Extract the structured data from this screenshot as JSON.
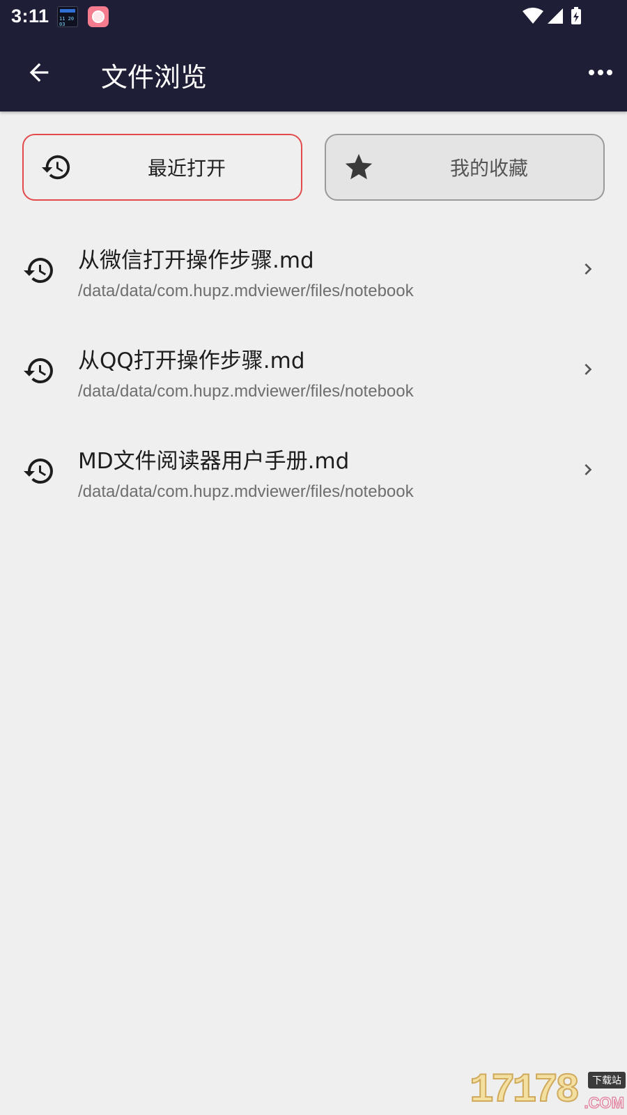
{
  "status_bar": {
    "time": "3:11",
    "icons": [
      "widget-clock-app-icon",
      "rice-bowl-app-icon",
      "wifi-icon",
      "cellular-signal-icon",
      "battery-charging-icon"
    ],
    "widget_digits": "11 20 03"
  },
  "header": {
    "title": "文件浏览",
    "back_icon": "arrow-back-icon",
    "menu_icon": "more-horizontal-icon",
    "background_color": "#1e1f36"
  },
  "tabs": [
    {
      "label": "最近打开",
      "icon": "history-icon",
      "selected": true,
      "border_color": "#e34a4a"
    },
    {
      "label": "我的收藏",
      "icon": "star-icon",
      "selected": false,
      "border_color": "#9a9a9a"
    }
  ],
  "files": [
    {
      "name": "从微信打开操作步骤.md",
      "path": "/data/data/com.hupz.mdviewer/files/notebook"
    },
    {
      "name": "从QQ打开操作步骤.md",
      "path": "/data/data/com.hupz.mdviewer/files/notebook"
    },
    {
      "name": "MD文件阅读器用户手册.md",
      "path": "/data/data/com.hupz.mdviewer/files/notebook"
    }
  ],
  "watermark": {
    "digits": "17178",
    "tag": "下载站",
    "suffix": ".COM"
  }
}
